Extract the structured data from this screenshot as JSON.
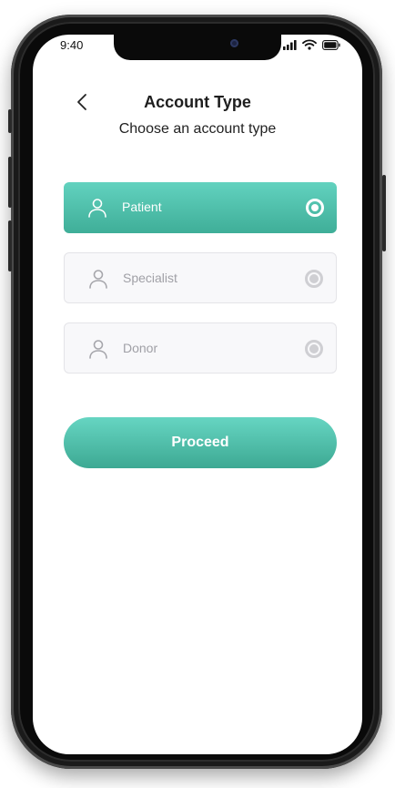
{
  "status_bar": {
    "time": "9:40",
    "icons": [
      "signal-icon",
      "wifi-icon",
      "battery-icon"
    ]
  },
  "header": {
    "back_icon": "chevron-left-icon",
    "title": "Account Type",
    "subtitle": "Choose an account type"
  },
  "account_types": {
    "options": [
      {
        "label": "Patient",
        "icon": "user-icon",
        "selected": true
      },
      {
        "label": "Specialist",
        "icon": "user-icon",
        "selected": false
      },
      {
        "label": "Donor",
        "icon": "user-icon",
        "selected": false
      }
    ]
  },
  "actions": {
    "proceed_label": "Proceed"
  },
  "colors": {
    "accent": "#4fc1ab",
    "accent_light": "#62d2bf",
    "accent_dark": "#3fae98",
    "unselected_bg": "#f8f8fa",
    "unselected_text": "#a0a0a6"
  }
}
